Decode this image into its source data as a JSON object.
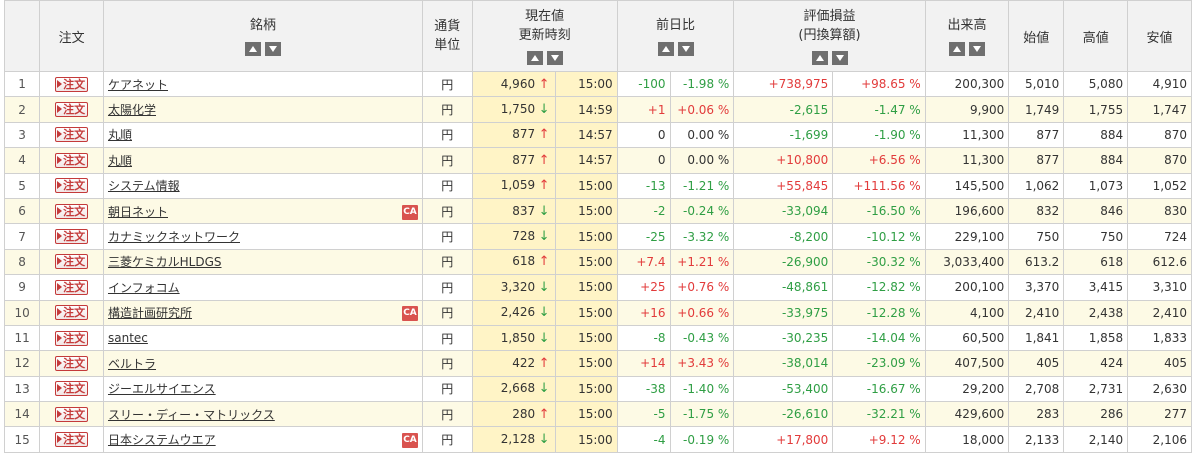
{
  "header": {
    "order": "注文",
    "name": "銘柄",
    "currency_line1": "通貨",
    "currency_line2": "単位",
    "price_line1": "現在値",
    "price_line2": "更新時刻",
    "change": "前日比",
    "pl_line1": "評価損益",
    "pl_line2": "(円換算額)",
    "volume": "出来高",
    "open": "始値",
    "high": "高値",
    "low": "安値"
  },
  "order_label": "注文",
  "ca_label": "CA",
  "colors": {
    "up": "#e23b3b",
    "down": "#2f9e44",
    "alt_row": "#fdfae5",
    "price_bg": "#fff4c6"
  },
  "rows": [
    {
      "idx": "1",
      "name": "ケアネット",
      "ca": false,
      "currency": "円",
      "price": "4,960",
      "dir": "up",
      "time": "15:00",
      "chg": "-100",
      "chg_pct": "-1.98 %",
      "chg_sign": "neg",
      "pl": "+738,975",
      "pl_pct": "+98.65 %",
      "pl_sign": "pos",
      "volume": "200,300",
      "open": "5,010",
      "high": "5,080",
      "low": "4,910"
    },
    {
      "idx": "2",
      "name": "太陽化学",
      "ca": false,
      "currency": "円",
      "price": "1,750",
      "dir": "down",
      "time": "14:59",
      "chg": "+1",
      "chg_pct": "+0.06 %",
      "chg_sign": "pos",
      "pl": "-2,615",
      "pl_pct": "-1.47 %",
      "pl_sign": "neg",
      "volume": "9,900",
      "open": "1,749",
      "high": "1,755",
      "low": "1,747"
    },
    {
      "idx": "3",
      "name": "丸順",
      "ca": false,
      "currency": "円",
      "price": "877",
      "dir": "up",
      "time": "14:57",
      "chg": "0",
      "chg_pct": "0.00 %",
      "chg_sign": "zero",
      "pl": "-1,699",
      "pl_pct": "-1.90 %",
      "pl_sign": "neg",
      "volume": "11,300",
      "open": "877",
      "high": "884",
      "low": "870"
    },
    {
      "idx": "4",
      "name": "丸順",
      "ca": false,
      "currency": "円",
      "price": "877",
      "dir": "up",
      "time": "14:57",
      "chg": "0",
      "chg_pct": "0.00 %",
      "chg_sign": "zero",
      "pl": "+10,800",
      "pl_pct": "+6.56 %",
      "pl_sign": "pos",
      "volume": "11,300",
      "open": "877",
      "high": "884",
      "low": "870"
    },
    {
      "idx": "5",
      "name": "システム情報",
      "ca": false,
      "currency": "円",
      "price": "1,059",
      "dir": "up",
      "time": "15:00",
      "chg": "-13",
      "chg_pct": "-1.21 %",
      "chg_sign": "neg",
      "pl": "+55,845",
      "pl_pct": "+111.56 %",
      "pl_sign": "pos",
      "volume": "145,500",
      "open": "1,062",
      "high": "1,073",
      "low": "1,052"
    },
    {
      "idx": "6",
      "name": "朝日ネット",
      "ca": true,
      "currency": "円",
      "price": "837",
      "dir": "down",
      "time": "15:00",
      "chg": "-2",
      "chg_pct": "-0.24 %",
      "chg_sign": "neg",
      "pl": "-33,094",
      "pl_pct": "-16.50 %",
      "pl_sign": "neg",
      "volume": "196,600",
      "open": "832",
      "high": "846",
      "low": "830"
    },
    {
      "idx": "7",
      "name": "カナミックネットワーク",
      "ca": false,
      "currency": "円",
      "price": "728",
      "dir": "down",
      "time": "15:00",
      "chg": "-25",
      "chg_pct": "-3.32 %",
      "chg_sign": "neg",
      "pl": "-8,200",
      "pl_pct": "-10.12 %",
      "pl_sign": "neg",
      "volume": "229,100",
      "open": "750",
      "high": "750",
      "low": "724"
    },
    {
      "idx": "8",
      "name": "三菱ケミカルHLDGS",
      "ca": false,
      "currency": "円",
      "price": "618",
      "dir": "up",
      "time": "15:00",
      "chg": "+7.4",
      "chg_pct": "+1.21 %",
      "chg_sign": "pos",
      "pl": "-26,900",
      "pl_pct": "-30.32 %",
      "pl_sign": "neg",
      "volume": "3,033,400",
      "open": "613.2",
      "high": "618",
      "low": "612.6"
    },
    {
      "idx": "9",
      "name": "インフォコム",
      "ca": false,
      "currency": "円",
      "price": "3,320",
      "dir": "down",
      "time": "15:00",
      "chg": "+25",
      "chg_pct": "+0.76 %",
      "chg_sign": "pos",
      "pl": "-48,861",
      "pl_pct": "-12.82 %",
      "pl_sign": "neg",
      "volume": "200,100",
      "open": "3,370",
      "high": "3,415",
      "low": "3,310"
    },
    {
      "idx": "10",
      "name": "構造計画研究所",
      "ca": true,
      "currency": "円",
      "price": "2,426",
      "dir": "down",
      "time": "15:00",
      "chg": "+16",
      "chg_pct": "+0.66 %",
      "chg_sign": "pos",
      "pl": "-33,975",
      "pl_pct": "-12.28 %",
      "pl_sign": "neg",
      "volume": "4,100",
      "open": "2,410",
      "high": "2,438",
      "low": "2,410"
    },
    {
      "idx": "11",
      "name": "santec",
      "ca": false,
      "currency": "円",
      "price": "1,850",
      "dir": "down",
      "time": "15:00",
      "chg": "-8",
      "chg_pct": "-0.43 %",
      "chg_sign": "neg",
      "pl": "-30,235",
      "pl_pct": "-14.04 %",
      "pl_sign": "neg",
      "volume": "60,500",
      "open": "1,841",
      "high": "1,858",
      "low": "1,833"
    },
    {
      "idx": "12",
      "name": "ベルトラ",
      "ca": false,
      "currency": "円",
      "price": "422",
      "dir": "up",
      "time": "15:00",
      "chg": "+14",
      "chg_pct": "+3.43 %",
      "chg_sign": "pos",
      "pl": "-38,014",
      "pl_pct": "-23.09 %",
      "pl_sign": "neg",
      "volume": "407,500",
      "open": "405",
      "high": "424",
      "low": "405"
    },
    {
      "idx": "13",
      "name": "ジーエルサイエンス",
      "ca": false,
      "currency": "円",
      "price": "2,668",
      "dir": "down",
      "time": "15:00",
      "chg": "-38",
      "chg_pct": "-1.40 %",
      "chg_sign": "neg",
      "pl": "-53,400",
      "pl_pct": "-16.67 %",
      "pl_sign": "neg",
      "volume": "29,200",
      "open": "2,708",
      "high": "2,731",
      "low": "2,630"
    },
    {
      "idx": "14",
      "name": "スリー・ディー・マトリックス",
      "ca": false,
      "currency": "円",
      "price": "280",
      "dir": "up",
      "time": "15:00",
      "chg": "-5",
      "chg_pct": "-1.75 %",
      "chg_sign": "neg",
      "pl": "-26,610",
      "pl_pct": "-32.21 %",
      "pl_sign": "neg",
      "volume": "429,600",
      "open": "283",
      "high": "286",
      "low": "277"
    },
    {
      "idx": "15",
      "name": "日本システムウエア",
      "ca": true,
      "currency": "円",
      "price": "2,128",
      "dir": "down",
      "time": "15:00",
      "chg": "-4",
      "chg_pct": "-0.19 %",
      "chg_sign": "neg",
      "pl": "+17,800",
      "pl_pct": "+9.12 %",
      "pl_sign": "pos",
      "volume": "18,000",
      "open": "2,133",
      "high": "2,140",
      "low": "2,106"
    }
  ]
}
